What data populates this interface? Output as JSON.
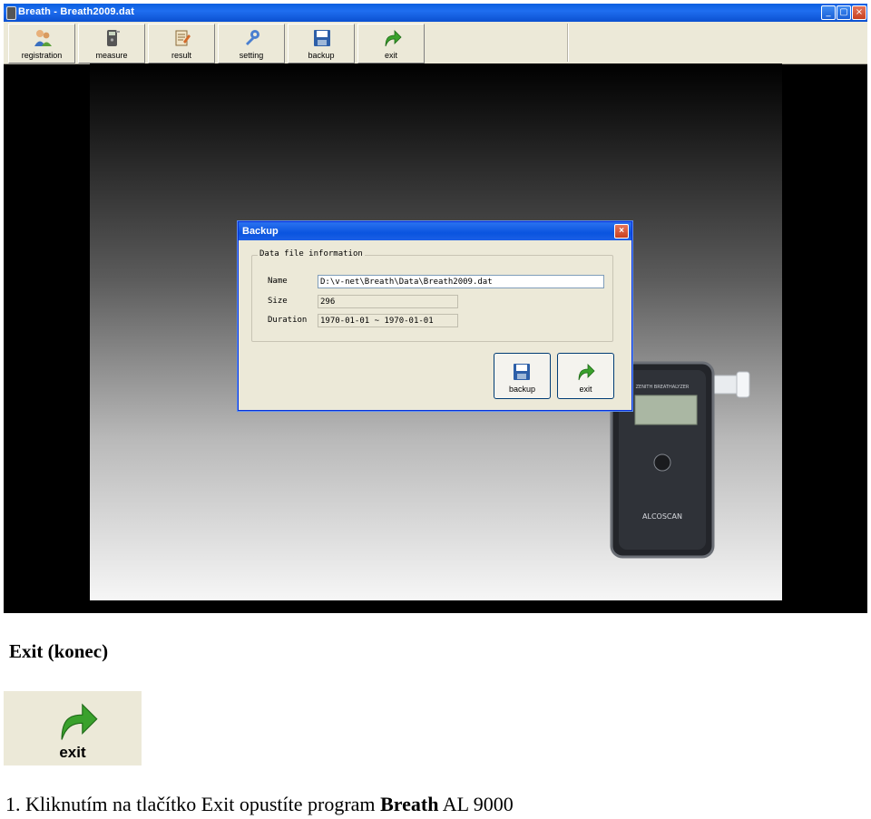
{
  "window": {
    "title": "Breath - Breath2009.dat",
    "controls": [
      "_",
      "▢",
      "×"
    ]
  },
  "toolbar": {
    "items": [
      {
        "label": "registration",
        "icon": "registration-icon"
      },
      {
        "label": "measure",
        "icon": "measure-icon"
      },
      {
        "label": "result",
        "icon": "result-icon"
      },
      {
        "label": "setting",
        "icon": "setting-icon"
      },
      {
        "label": "backup",
        "icon": "save-icon"
      },
      {
        "label": "exit",
        "icon": "exit-arrow-icon"
      }
    ]
  },
  "dialog": {
    "title": "Backup",
    "close": "×",
    "group_title": "Data file information",
    "fields": [
      {
        "label": "Name",
        "value": "D:\\v-net\\Breath\\Data\\Breath2009.dat"
      },
      {
        "label": "Size",
        "value": "296"
      },
      {
        "label": "Duration",
        "value": "1970-01-01 ~ 1970-01-01"
      }
    ],
    "buttons": {
      "backup": "backup",
      "exit": "exit"
    }
  },
  "device": {
    "brand": "ALCOSCAN",
    "model_text": "ZENITH BREATHALYZER"
  },
  "doc": {
    "heading": "Exit (konec)",
    "exit_button_label": "exit",
    "caption_prefix": "1. Kliknutím na tlačítko Exit opustíte program ",
    "caption_bold": "Breath",
    "caption_suffix": " AL 9000"
  },
  "colors": {
    "titlebar": "#0a54df",
    "toolbar_bg": "#ece9d8",
    "exit_arrow": "#3aa12c"
  }
}
